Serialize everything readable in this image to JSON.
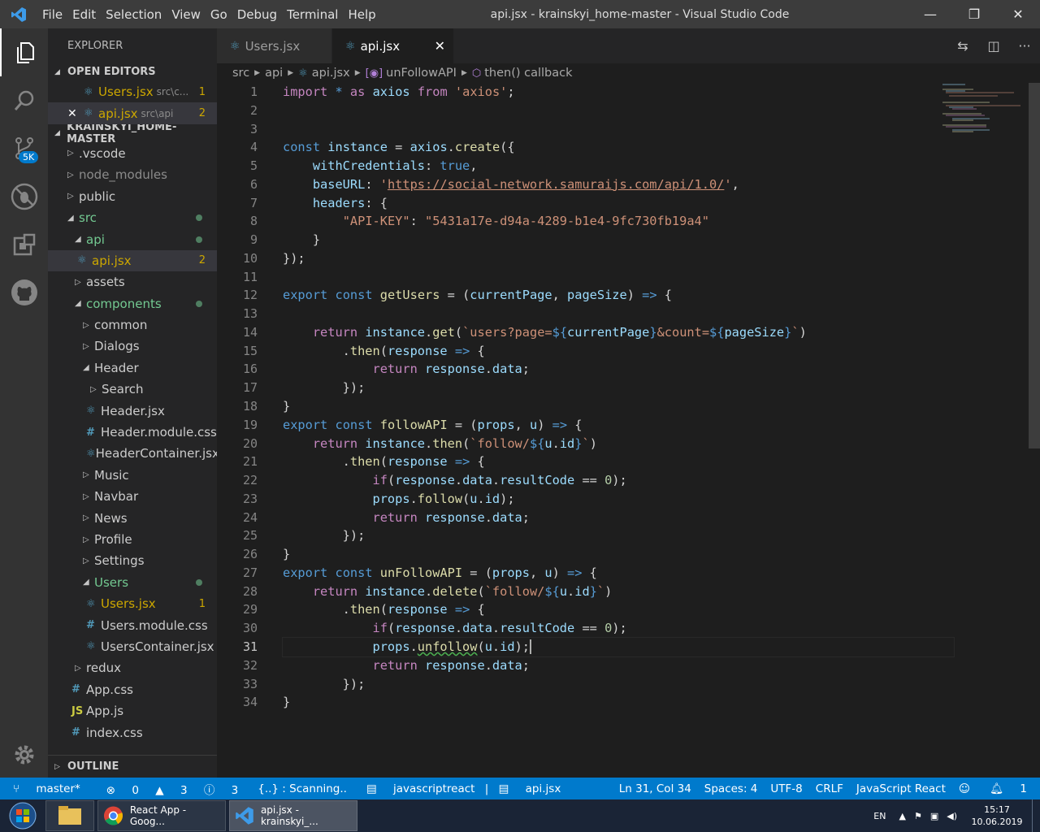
{
  "window": {
    "title": "api.jsx - krainskyi_home-master - Visual Studio Code",
    "menu": [
      "File",
      "Edit",
      "Selection",
      "View",
      "Go",
      "Debug",
      "Terminal",
      "Help"
    ]
  },
  "activity_bar": {
    "items": [
      "files-icon",
      "search-icon",
      "source-control-icon",
      "debug-icon",
      "extensions-icon",
      "github-icon"
    ],
    "scm_badge": "5K"
  },
  "sidebar": {
    "title": "EXPLORER",
    "open_editors_label": "OPEN EDITORS",
    "open_editors": [
      {
        "name": "Users.jsx",
        "path": "src\\c...",
        "count": "1"
      },
      {
        "name": "api.jsx",
        "path": "src\\api",
        "count": "2",
        "close": "✕"
      }
    ],
    "project_label": "KRAINSKYI_HOME-MASTER",
    "tree": [
      {
        "label": ".vscode"
      },
      {
        "label": "node_modules"
      },
      {
        "label": "public"
      },
      {
        "label": "src"
      },
      {
        "label": "api"
      },
      {
        "label": "api.jsx",
        "count": "2"
      },
      {
        "label": "assets"
      },
      {
        "label": "components"
      },
      {
        "label": "common"
      },
      {
        "label": "Dialogs"
      },
      {
        "label": "Header"
      },
      {
        "label": "Search"
      },
      {
        "label": "Header.jsx"
      },
      {
        "label": "Header.module.css"
      },
      {
        "label": "HeaderContainer.jsx"
      },
      {
        "label": "Music"
      },
      {
        "label": "Navbar"
      },
      {
        "label": "News"
      },
      {
        "label": "Profile"
      },
      {
        "label": "Settings"
      },
      {
        "label": "Users"
      },
      {
        "label": "Users.jsx",
        "count": "1"
      },
      {
        "label": "Users.module.css"
      },
      {
        "label": "UsersContainer.jsx"
      },
      {
        "label": "redux"
      },
      {
        "label": "App.css"
      },
      {
        "label": "App.js"
      },
      {
        "label": "index.css"
      }
    ],
    "outline_label": "OUTLINE",
    "icons": {
      "css": "#",
      "js": "JS"
    }
  },
  "tabs": [
    {
      "label": "Users.jsx"
    },
    {
      "label": "api.jsx",
      "active": true,
      "close": "✕"
    }
  ],
  "breadcrumb": [
    "src",
    "api",
    "api.jsx",
    "unFollowAPI",
    "then() callback"
  ],
  "editor": {
    "current_line": 31,
    "line_count": 34
  },
  "status_bar": {
    "branch": "master*",
    "errors": "0",
    "warnings": "3",
    "infos": "3",
    "scanning": "{..} : Scanning..",
    "language_server": "javascriptreact",
    "file": "api.jsx",
    "position": "Ln 31, Col 34",
    "spaces": "Spaces: 4",
    "encoding": "UTF-8",
    "eol": "CRLF",
    "language": "JavaScript React",
    "notifications": "1"
  },
  "taskbar": {
    "items": [
      {
        "label": "React App - Goog..."
      },
      {
        "label": "api.jsx - krainskyi_..."
      }
    ],
    "lang": "EN",
    "time": "15:17",
    "date": "10.06.2019"
  },
  "colors": {
    "accent": "#007acc",
    "keyword": "#569cd6",
    "control": "#c586c0",
    "variable": "#9cdcfe",
    "function": "#dcdcaa",
    "string": "#ce9178",
    "number": "#b5cea8"
  }
}
